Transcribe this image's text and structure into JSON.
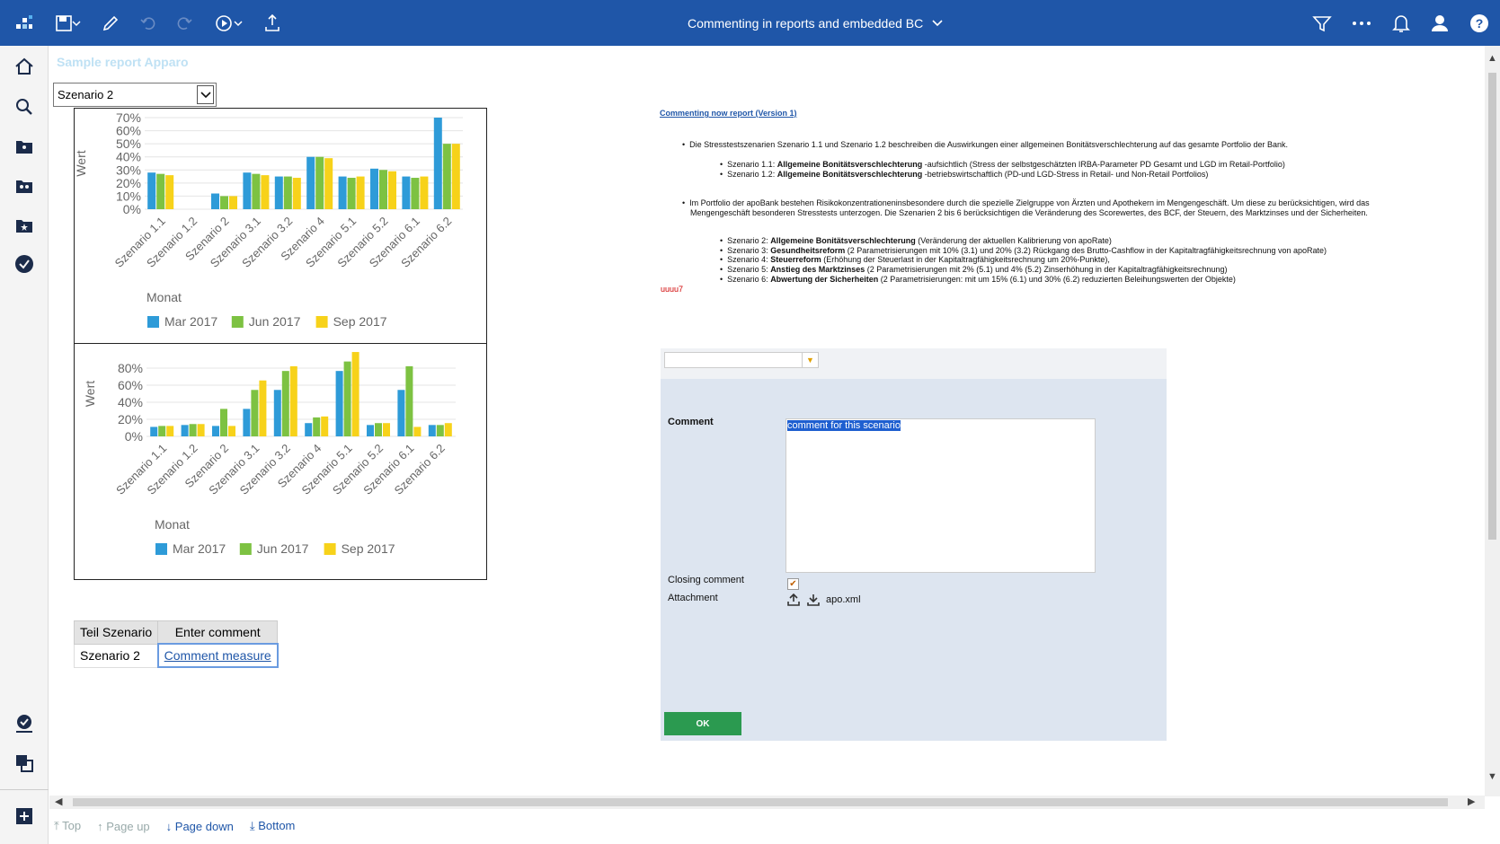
{
  "app": {
    "title": "Commenting in reports and embedded BC"
  },
  "report": {
    "title": "Sample report Apparo",
    "select_value": "Szenario 2",
    "chart1": {
      "y_label": "Wert",
      "x_label": "Monat",
      "y_ticks": [
        "70%",
        "60%",
        "50%",
        "40%",
        "30%",
        "20%",
        "10%",
        "0%"
      ],
      "categories": [
        "Szenario 1.1",
        "Szenario 1.2",
        "Szenario 2",
        "Szenario 3.1",
        "Szenario 3.2",
        "Szenario 4",
        "Szenario 5.1",
        "Szenario 5.2",
        "Szenario 6.1",
        "Szenario 6.2"
      ],
      "legend": [
        "Mar 2017",
        "Jun 2017",
        "Sep 2017"
      ]
    },
    "chart2": {
      "y_label": "Wert",
      "x_label": "Monat",
      "y_ticks": [
        "80%",
        "60%",
        "40%",
        "20%",
        "0%"
      ],
      "categories": [
        "Szenario 1.1",
        "Szenario 1.2",
        "Szenario 2",
        "Szenario 3.1",
        "Szenario 3.2",
        "Szenario 4",
        "Szenario 5.1",
        "Szenario 5.2",
        "Szenario 6.1",
        "Szenario 6.2"
      ],
      "legend": [
        "Mar 2017",
        "Jun 2017",
        "Sep 2017"
      ]
    },
    "table": {
      "headers": [
        "Teil Szenario",
        "Enter comment"
      ],
      "row": [
        "Szenario 2",
        "Comment measure"
      ]
    }
  },
  "right_text": {
    "link": "Commenting now report (Version 1)",
    "bullet1": "Die Stresstestszenarien Szenario 1.1 und Szenario 1.2 beschreiben die Auswirkungen einer allgemeinen Bonitätsverschlechterung auf das gesamte Portfolio der Bank.",
    "sub1a_pre": "Szenario 1.1: ",
    "sub1a_bold": "Allgemeine Bonitätsverschlechterung",
    "sub1a_post": " -aufsichtlich (Stress der selbstgeschätzten IRBA-Parameter PD Gesamt und LGD im Retail-Portfolio)",
    "sub1b_pre": "Szenario 1.2: ",
    "sub1b_bold": "Allgemeine Bonitätsverschlechterung",
    "sub1b_post": " -betriebswirtschaftlich (PD-und LGD-Stress in Retail- und Non-Retail Portfolios)",
    "bullet2_l1": "Im Portfolio der apoBank bestehen Risikokonzentrationeninsbesondere durch die spezielle Zielgruppe von Ärzten und Apothekern im Mengengeschäft. Um diese zu berücksichtigen, wird das",
    "bullet2_l2": "Mengengeschäft besonderen Stresstests unterzogen. Die Szenarien 2 bis 6 berücksichtigen die Veränderung des Scorewertes, des BCF, der Steuern, des Marktzinses und der Sicherheiten.",
    "s2_pre": "Szenario 2: ",
    "s2_bold": "Allgemeine Bonitätsverschlechterung",
    "s2_post": " (Veränderung der aktuellen Kalibrierung von apoRate)",
    "s3_pre": "Szenario 3: ",
    "s3_bold": "Gesundheitsreform",
    "s3_post": " (2 Parametrisierungen mit 10% (3.1) und 20% (3.2) Rückgang des Brutto-Cashflow in der Kapitaltragfähigkeitsrechnung von apoRate)",
    "s4_pre": "Szenario 4: ",
    "s4_bold": "Steuerreform",
    "s4_post": " (Erhöhung der Steuerlast in der Kapitaltragfähigkeitsrechnung um 20%-Punkte),",
    "s5_pre": "Szenario 5: ",
    "s5_bold": "Anstieg des Marktzinses",
    "s5_post": "  (2 Parametrisierungen mit 2% (5.1) und 4% (5.2) Zinserhöhung in der Kapitaltragfähigkeitsrechnung)",
    "s6_pre": "Szenario 6: ",
    "s6_bold": "Abwertung der Sicherheiten",
    "s6_post": "  (2 Parametrisierungen: mit um 15% (6.1) und 30% (6.2) reduzierten Beleihungswerten der Objekte)",
    "red_text": "uuuu7"
  },
  "comment_panel": {
    "comment_label": "Comment",
    "comment_value": "comment for this scenario",
    "closing_label": "Closing comment",
    "attachment_label": "Attachment",
    "attachment_file": "apo.xml",
    "ok_label": "OK"
  },
  "pager": {
    "top": "Top",
    "page_up": "Page up",
    "page_down": "Page down",
    "bottom": "Bottom"
  },
  "chart_data": [
    {
      "type": "bar",
      "ylabel": "Wert",
      "xlabel": "Monat",
      "ylim": [
        0,
        70
      ],
      "categories": [
        "Szenario 1.1",
        "Szenario 1.2",
        "Szenario 2",
        "Szenario 3.1",
        "Szenario 3.2",
        "Szenario 4",
        "Szenario 5.1",
        "Szenario 5.2",
        "Szenario 6.1",
        "Szenario 6.2"
      ],
      "series": [
        {
          "name": "Mar 2017",
          "values": [
            28,
            0,
            12,
            28,
            25,
            40,
            25,
            31,
            25,
            70
          ]
        },
        {
          "name": "Jun 2017",
          "values": [
            27,
            0,
            10,
            27,
            25,
            40,
            24,
            30,
            24,
            50
          ]
        },
        {
          "name": "Sep 2017",
          "values": [
            26,
            0,
            10,
            26,
            24,
            39,
            25,
            29,
            25,
            50
          ]
        }
      ]
    },
    {
      "type": "bar",
      "ylabel": "Wert",
      "xlabel": "Monat",
      "ylim": [
        0,
        90
      ],
      "categories": [
        "Szenario 1.1",
        "Szenario 1.2",
        "Szenario 2",
        "Szenario 3.1",
        "Szenario 3.2",
        "Szenario 4",
        "Szenario 5.1",
        "Szenario 5.2",
        "Szenario 6.1",
        "Szenario 6.2"
      ],
      "series": [
        {
          "name": "Mar 2017",
          "values": [
            10,
            12,
            11,
            29,
            49,
            14,
            69,
            12,
            49,
            12
          ]
        },
        {
          "name": "Jun 2017",
          "values": [
            11,
            13,
            29,
            49,
            69,
            20,
            79,
            14,
            74,
            12
          ]
        },
        {
          "name": "Sep 2017",
          "values": [
            11,
            13,
            11,
            59,
            74,
            21,
            89,
            14,
            10,
            14
          ]
        }
      ]
    }
  ],
  "colors": {
    "topbar": "#1f56a8",
    "series": [
      "#2e9bd8",
      "#7dc242",
      "#f7d21a"
    ]
  }
}
